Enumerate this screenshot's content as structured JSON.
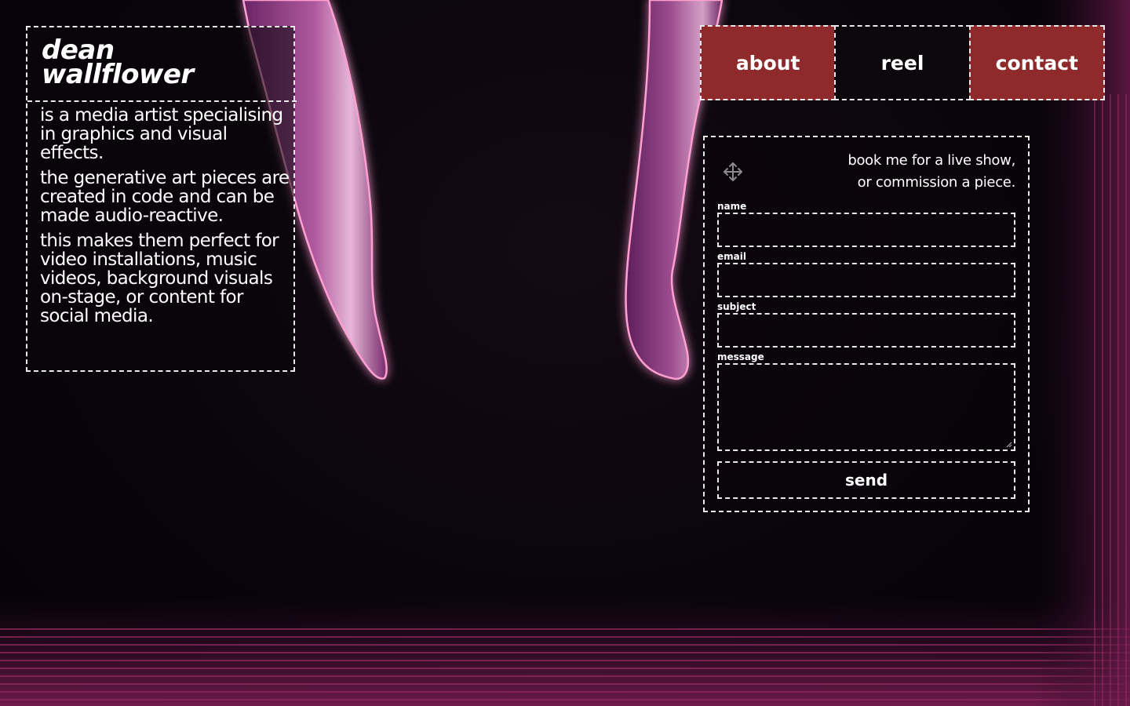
{
  "intro": {
    "title_line1": "dean",
    "title_line2": "wallflower",
    "paragraphs": [
      "is a media artist specialising in graphics and visual effects.",
      "the generative art pieces are created in code and can be made audio-reactive.",
      "this makes them perfect for video installations, music videos, background visuals on-stage, or content for social media."
    ]
  },
  "nav": {
    "items": [
      {
        "label": "about"
      },
      {
        "label": "reel"
      },
      {
        "label": "contact"
      }
    ]
  },
  "contact": {
    "intro_line1": "book me for a live show,",
    "intro_line2": "or commission a piece.",
    "fields": {
      "name": {
        "label": "name",
        "value": ""
      },
      "email": {
        "label": "email",
        "value": ""
      },
      "subject": {
        "label": "subject",
        "value": ""
      },
      "message": {
        "label": "message",
        "value": ""
      }
    },
    "send_label": "send",
    "move_icon": "move-icon"
  },
  "colors": {
    "accent_red": "#8e2a2c",
    "background": "#07030a",
    "border": "#e9e9e9",
    "glow_pink": "#e05a8a",
    "purple_art": "#8a3a7e"
  }
}
